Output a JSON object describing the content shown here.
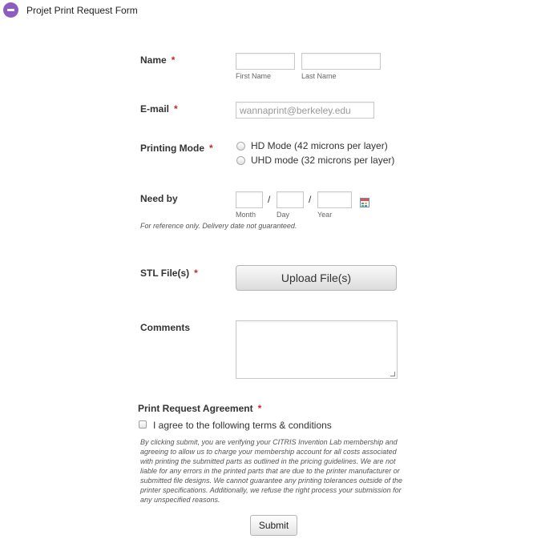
{
  "header": {
    "title": "Projet Print Request Form",
    "icon": "minus-circle-icon",
    "icon_color": "#8e5bbf"
  },
  "name": {
    "label": "Name",
    "required": "*",
    "first_sub": "First Name",
    "last_sub": "Last Name",
    "first_value": "",
    "last_value": ""
  },
  "email": {
    "label": "E-mail",
    "required": "*",
    "placeholder": "wannaprint@berkeley.edu"
  },
  "printing_mode": {
    "label": "Printing Mode",
    "required": "*",
    "options": [
      "HD Mode (42 microns per layer)",
      "UHD mode (32 microns per layer)"
    ],
    "selected": null
  },
  "need_by": {
    "label": "Need by",
    "sub_month": "Month",
    "sub_day": "Day",
    "sub_year": "Year",
    "separator": "/",
    "note": "For reference only. Delivery date not guaranteed.",
    "icon": "calendar-icon"
  },
  "stl": {
    "label": "STL File(s)",
    "required": "*",
    "button": "Upload File(s)"
  },
  "comments": {
    "label": "Comments",
    "value": ""
  },
  "agreement": {
    "label": "Print Request Agreement",
    "required": "*",
    "checkbox_label": "I agree to the following terms & conditions",
    "checked": false,
    "text": "By clicking submit, you are verifying your CITRIS Invention Lab membership and agreeing to allow us to charge your membership account for all costs associated with printing the submitted parts as outlined in the pricing guidelines. We are not liable for any errors in the printed parts that are due to the printer manufacturer or submitted file designs. We cannot guarantee any printing tolerances outside of the printer specifications. Additionally, we refuse the right process your submission for any unspecified reasons."
  },
  "submit": {
    "label": "Submit"
  },
  "colors": {
    "required": "#c62828",
    "text": "#333333"
  }
}
